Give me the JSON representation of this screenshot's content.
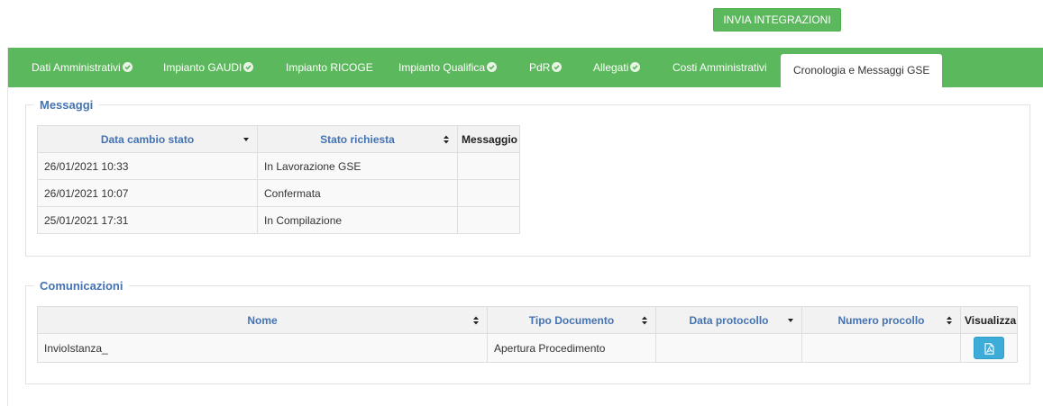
{
  "toolbar": {
    "invia_label": "INVIA INTEGRAZIONI"
  },
  "tabs": [
    {
      "label": "Dati Amministrativi",
      "checked": true
    },
    {
      "label": "Impianto GAUDI",
      "checked": true
    },
    {
      "label": "Impianto RICOGE",
      "checked": false
    },
    {
      "label": "Impianto Qualifica",
      "checked": true
    },
    {
      "label": "PdR",
      "checked": true
    },
    {
      "label": "Allegati",
      "checked": true
    },
    {
      "label": "Costi Amministrativi",
      "checked": false
    },
    {
      "label": "Cronologia e Messaggi GSE",
      "checked": false,
      "active": true
    }
  ],
  "messaggi": {
    "legend": "Messaggi",
    "columns": [
      "Data cambio stato",
      "Stato richiesta",
      "Messaggio"
    ],
    "rows": [
      {
        "data": "26/01/2021 10:33",
        "stato": "In Lavorazione GSE",
        "messaggio": ""
      },
      {
        "data": "26/01/2021 10:07",
        "stato": "Confermata",
        "messaggio": ""
      },
      {
        "data": "25/01/2021 17:31",
        "stato": "In Compilazione",
        "messaggio": ""
      }
    ]
  },
  "comunicazioni": {
    "legend": "Comunicazioni",
    "columns": [
      "Nome",
      "Tipo Documento",
      "Data protocollo",
      "Numero procollo",
      "Visualizza"
    ],
    "rows": [
      {
        "nome": "InvioIstanza_",
        "tipo": "Apertura Procedimento",
        "data_protocollo": "",
        "numero": ""
      }
    ]
  },
  "colors": {
    "accent_green": "#5cb85c",
    "header_blue": "#4473b3",
    "pdf_button": "#3eacd8"
  },
  "icons": {
    "tab_check": "check-circle-icon",
    "sort_both": "sort-icon",
    "sort_down": "caret-down-icon",
    "pdf": "file-pdf-icon"
  }
}
